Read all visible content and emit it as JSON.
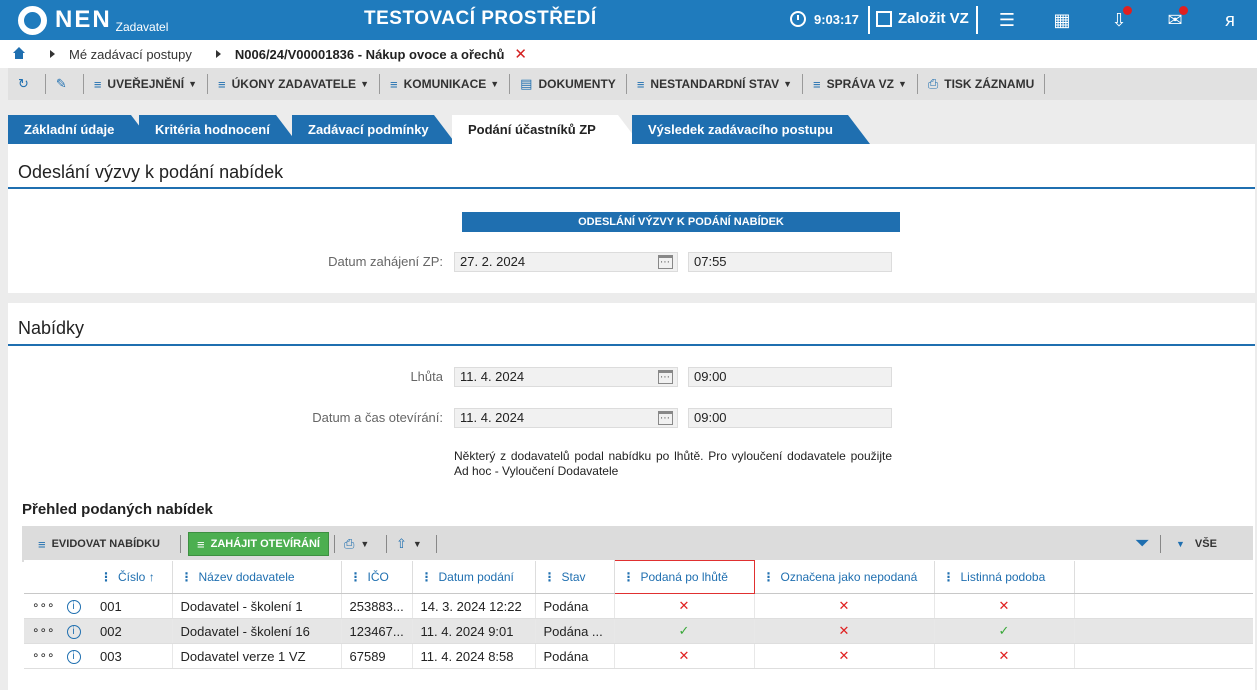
{
  "header": {
    "logo_text": "NEN",
    "logo_sub": "Zadavatel",
    "env_title": "TESTOVACÍ PROSTŘEDÍ",
    "clock": "9:03:17",
    "create_label": "Založit VZ"
  },
  "breadcrumb": {
    "item1": "Mé zadávací postupy",
    "item2": "N006/24/V00001836 - Nákup ovoce a ořechů"
  },
  "actionbar": {
    "uverejneni": "UVEŘEJNĚNÍ",
    "ukony": "ÚKONY ZADAVATELE",
    "komunikace": "KOMUNIKACE",
    "dokumenty": "DOKUMENTY",
    "nestandardni": "NESTANDARDNÍ STAV",
    "sprava": "SPRÁVA VZ",
    "tisk": "TISK ZÁZNAMU"
  },
  "tabs": [
    "Základní údaje",
    "Kritéria hodnocení",
    "Zadávací podmínky",
    "Podání účastníků ZP",
    "Výsledek zadávacího postupu"
  ],
  "panel1": {
    "title": "Odeslání výzvy k podání nabídek",
    "section_head": "ODESLÁNÍ VÝZVY K PODÁNÍ NABÍDEK",
    "datum_label": "Datum zahájení ZP:",
    "datum_value": "27. 2. 2024",
    "time_value": "07:55"
  },
  "panel2": {
    "title": "Nabídky",
    "lhuta_label": "Lhůta",
    "lhuta_date": "11. 4. 2024",
    "lhuta_time": "09:00",
    "oteviravi_label": "Datum a čas otevírání:",
    "oteviravi_date": "11. 4. 2024",
    "oteviravi_time": "09:00",
    "note": "Některý z dodavatelů podal nabídku po lhůtě. Pro vyloučení dodavatele použijte Ad hoc - Vyloučení Dodavatele"
  },
  "grid": {
    "title": "Přehled podaných nabídek",
    "btn_evidovat": "EVIDOVAT NABÍDKU",
    "btn_zahajit": "ZAHÁJIT OTEVÍRÁNÍ",
    "filter_all": "VŠE",
    "columns": [
      "Číslo",
      "Název dodavatele",
      "IČO",
      "Datum podání",
      "Stav",
      "Podaná po lhůtě",
      "Označena jako nepodaná",
      "Listinná podoba"
    ],
    "rows": [
      {
        "cislo": "001",
        "nazev": "Dodavatel - školení 1",
        "ico": "253883...",
        "datum": "14. 3. 2024 12:22",
        "stav": "Podána",
        "po_lhute": "no",
        "nepodana": "no",
        "listinna": "no"
      },
      {
        "cislo": "002",
        "nazev": "Dodavatel - školení 16",
        "ico": "123467...",
        "datum": "11. 4. 2024 9:01",
        "stav": "Podána ...",
        "po_lhute": "yes",
        "nepodana": "no",
        "listinna": "yes"
      },
      {
        "cislo": "003",
        "nazev": "Dodavatel verze 1 VZ",
        "ico": "67589",
        "datum": "11. 4. 2024 8:58",
        "stav": "Podána",
        "po_lhute": "no",
        "nepodana": "no",
        "listinna": "no"
      }
    ]
  },
  "colors": {
    "primary": "#1f6fb0",
    "topbar": "#1f7bbd",
    "green": "#4caf50",
    "error": "#e02020"
  }
}
